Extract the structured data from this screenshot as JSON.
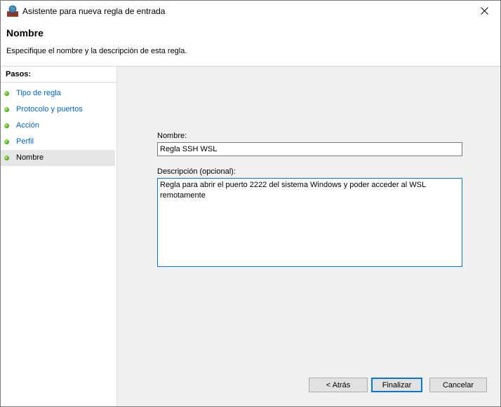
{
  "window": {
    "title": "Asistente para nueva regla de entrada"
  },
  "header": {
    "title": "Nombre",
    "subtitle": "Especifique el nombre y la descripción de esta regla."
  },
  "sidebar": {
    "heading": "Pasos:",
    "steps": [
      {
        "label": "Tipo de regla",
        "status": "completed"
      },
      {
        "label": "Protocolo y puertos",
        "status": "completed"
      },
      {
        "label": "Acción",
        "status": "completed"
      },
      {
        "label": "Perfil",
        "status": "completed"
      },
      {
        "label": "Nombre",
        "status": "current"
      }
    ]
  },
  "form": {
    "name_label": "Nombre:",
    "name_value": "Regla SSH WSL",
    "description_label": "Descripción (opcional):",
    "description_value": "Regla para abrir el puerto 2222 del sistema Windows y poder acceder al WSL remotamente"
  },
  "buttons": {
    "back": "< Atrás",
    "finish": "Finalizar",
    "cancel": "Cancelar"
  },
  "colors": {
    "accent": "#0078d7",
    "link": "#0066cc",
    "step_dot": "#3ea81a"
  }
}
